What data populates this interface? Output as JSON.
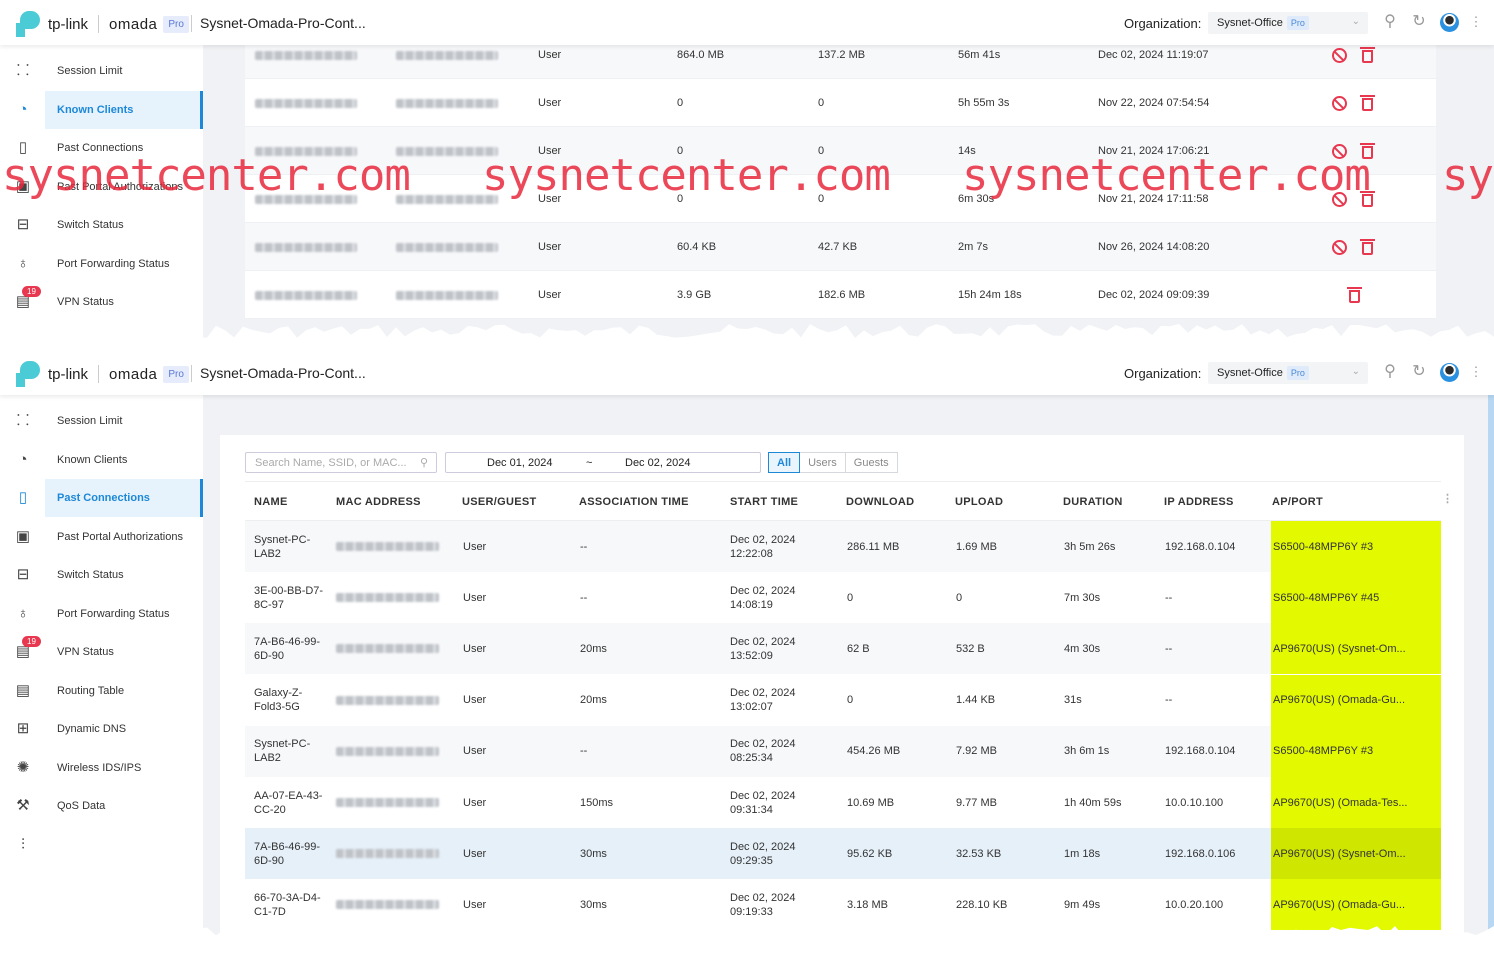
{
  "header": {
    "brand": "tp-link",
    "product": "omada",
    "edition": "Pro",
    "site": "Sysnet-Omada-Pro-Cont...",
    "org_label": "Organization:",
    "org_value": "Sysnet-Office",
    "org_badge": "Pro",
    "icons": [
      "search-icon",
      "refresh-icon",
      "avatar",
      "more-icon"
    ]
  },
  "watermark": "sysnetcenter.com",
  "top": {
    "sidebar": [
      {
        "label": "Session Limit",
        "icon": "dashboard-icon"
      },
      {
        "label": "Known Clients",
        "icon": "pie-chart-icon",
        "active": true
      },
      {
        "label": "Past Connections",
        "icon": "map-icon"
      },
      {
        "label": "Past Portal Authorizations",
        "icon": "device-icon"
      },
      {
        "label": "Switch Status",
        "icon": "switch-icon"
      },
      {
        "label": "Port Forwarding Status",
        "icon": "bulb-icon"
      },
      {
        "label": "VPN Status",
        "icon": "log-icon",
        "badge": "19"
      }
    ],
    "rows": [
      {
        "type": "User",
        "download": "864.0 MB",
        "upload": "137.2 MB",
        "duration": "56m 41s",
        "last_seen": "Dec 02, 2024 11:19:07",
        "block": true
      },
      {
        "type": "User",
        "download": "0",
        "upload": "0",
        "duration": "5h 55m 3s",
        "last_seen": "Nov 22, 2024 07:54:54",
        "block": true
      },
      {
        "type": "User",
        "download": "0",
        "upload": "0",
        "duration": "14s",
        "last_seen": "Nov 21, 2024 17:06:21",
        "block": true
      },
      {
        "type": "User",
        "download": "0",
        "upload": "0",
        "duration": "6m 30s",
        "last_seen": "Nov 21, 2024 17:11:58",
        "block": true
      },
      {
        "type": "User",
        "download": "60.4 KB",
        "upload": "42.7 KB",
        "duration": "2m 7s",
        "last_seen": "Nov 26, 2024 14:08:20",
        "block": true
      },
      {
        "type": "User",
        "download": "3.9 GB",
        "upload": "182.6 MB",
        "duration": "15h 24m 18s",
        "last_seen": "Dec 02, 2024 09:09:39",
        "block": false
      }
    ]
  },
  "bottom": {
    "sidebar": [
      {
        "label": "Session Limit",
        "icon": "dashboard-icon"
      },
      {
        "label": "Known Clients",
        "icon": "pie-chart-icon"
      },
      {
        "label": "Past Connections",
        "icon": "map-icon",
        "active": true
      },
      {
        "label": "Past Portal Authorizations",
        "icon": "device-icon"
      },
      {
        "label": "Switch Status",
        "icon": "switch-icon"
      },
      {
        "label": "Port Forwarding Status",
        "icon": "bulb-icon"
      },
      {
        "label": "VPN Status",
        "icon": "log-icon",
        "badge": "19"
      },
      {
        "label": "Routing Table",
        "icon": "document-icon"
      },
      {
        "label": "Dynamic DNS",
        "icon": "dns-icon"
      },
      {
        "label": "Wireless IDS/IPS",
        "icon": "ids-icon"
      },
      {
        "label": "QoS Data",
        "icon": "wrench-icon"
      },
      {
        "label": "",
        "icon": "insight-icon"
      }
    ],
    "filters": {
      "search_placeholder": "Search Name, SSID, or MAC...",
      "date_from": "Dec 01, 2024",
      "date_sep": "~",
      "date_to": "Dec 02, 2024",
      "segments": [
        "All",
        "Users",
        "Guests"
      ],
      "active_segment": "All"
    },
    "columns": [
      "NAME",
      "MAC ADDRESS",
      "USER/GUEST",
      "ASSOCIATION TIME",
      "START TIME",
      "DOWNLOAD",
      "UPLOAD",
      "DURATION",
      "IP ADDRESS",
      "AP/PORT"
    ],
    "highlight_color": "#e2f900",
    "rows": [
      {
        "name": "Sysnet-PC-LAB2",
        "type": "User",
        "assoc": "--",
        "start_date": "Dec 02, 2024",
        "start_time": "12:22:08",
        "download": "286.11 MB",
        "upload": "1.69 MB",
        "duration": "3h 5m 26s",
        "ip": "192.168.0.104",
        "ap": "S6500-48MPP6Y #3"
      },
      {
        "name": "3E-00-BB-D7-8C-97",
        "type": "User",
        "assoc": "--",
        "start_date": "Dec 02, 2024",
        "start_time": "14:08:19",
        "download": "0",
        "upload": "0",
        "duration": "7m 30s",
        "ip": "--",
        "ap": "S6500-48MPP6Y #45"
      },
      {
        "name": "7A-B6-46-99-6D-90",
        "type": "User",
        "assoc": "20ms",
        "start_date": "Dec 02, 2024",
        "start_time": "13:52:09",
        "download": "62 B",
        "upload": "532 B",
        "duration": "4m 30s",
        "ip": "--",
        "ap": "AP9670(US) (Sysnet-Om..."
      },
      {
        "name": "Galaxy-Z-Fold3-5G",
        "type": "User",
        "assoc": "20ms",
        "start_date": "Dec 02, 2024",
        "start_time": "13:02:07",
        "download": "0",
        "upload": "1.44 KB",
        "duration": "31s",
        "ip": "--",
        "ap": "AP9670(US) (Omada-Gu..."
      },
      {
        "name": "Sysnet-PC-LAB2",
        "type": "User",
        "assoc": "--",
        "start_date": "Dec 02, 2024",
        "start_time": "08:25:34",
        "download": "454.26 MB",
        "upload": "7.92 MB",
        "duration": "3h 6m 1s",
        "ip": "192.168.0.104",
        "ap": "S6500-48MPP6Y #3"
      },
      {
        "name": "AA-07-EA-43-CC-20",
        "type": "User",
        "assoc": "150ms",
        "start_date": "Dec 02, 2024",
        "start_time": "09:31:34",
        "download": "10.69 MB",
        "upload": "9.77 MB",
        "duration": "1h 40m 59s",
        "ip": "10.0.10.100",
        "ap": "AP9670(US) (Omada-Tes..."
      },
      {
        "name": "7A-B6-46-99-6D-90",
        "type": "User",
        "assoc": "30ms",
        "start_date": "Dec 02, 2024",
        "start_time": "09:29:35",
        "download": "95.62 KB",
        "upload": "32.53 KB",
        "duration": "1m 18s",
        "ip": "192.168.0.106",
        "ap": "AP9670(US) (Sysnet-Om...",
        "selected": true
      },
      {
        "name": "66-70-3A-D4-C1-7D",
        "type": "User",
        "assoc": "30ms",
        "start_date": "Dec 02, 2024",
        "start_time": "09:19:33",
        "download": "3.18 MB",
        "upload": "228.10 KB",
        "duration": "9m 49s",
        "ip": "10.0.20.100",
        "ap": "AP9670(US) (Omada-Gu..."
      }
    ]
  }
}
